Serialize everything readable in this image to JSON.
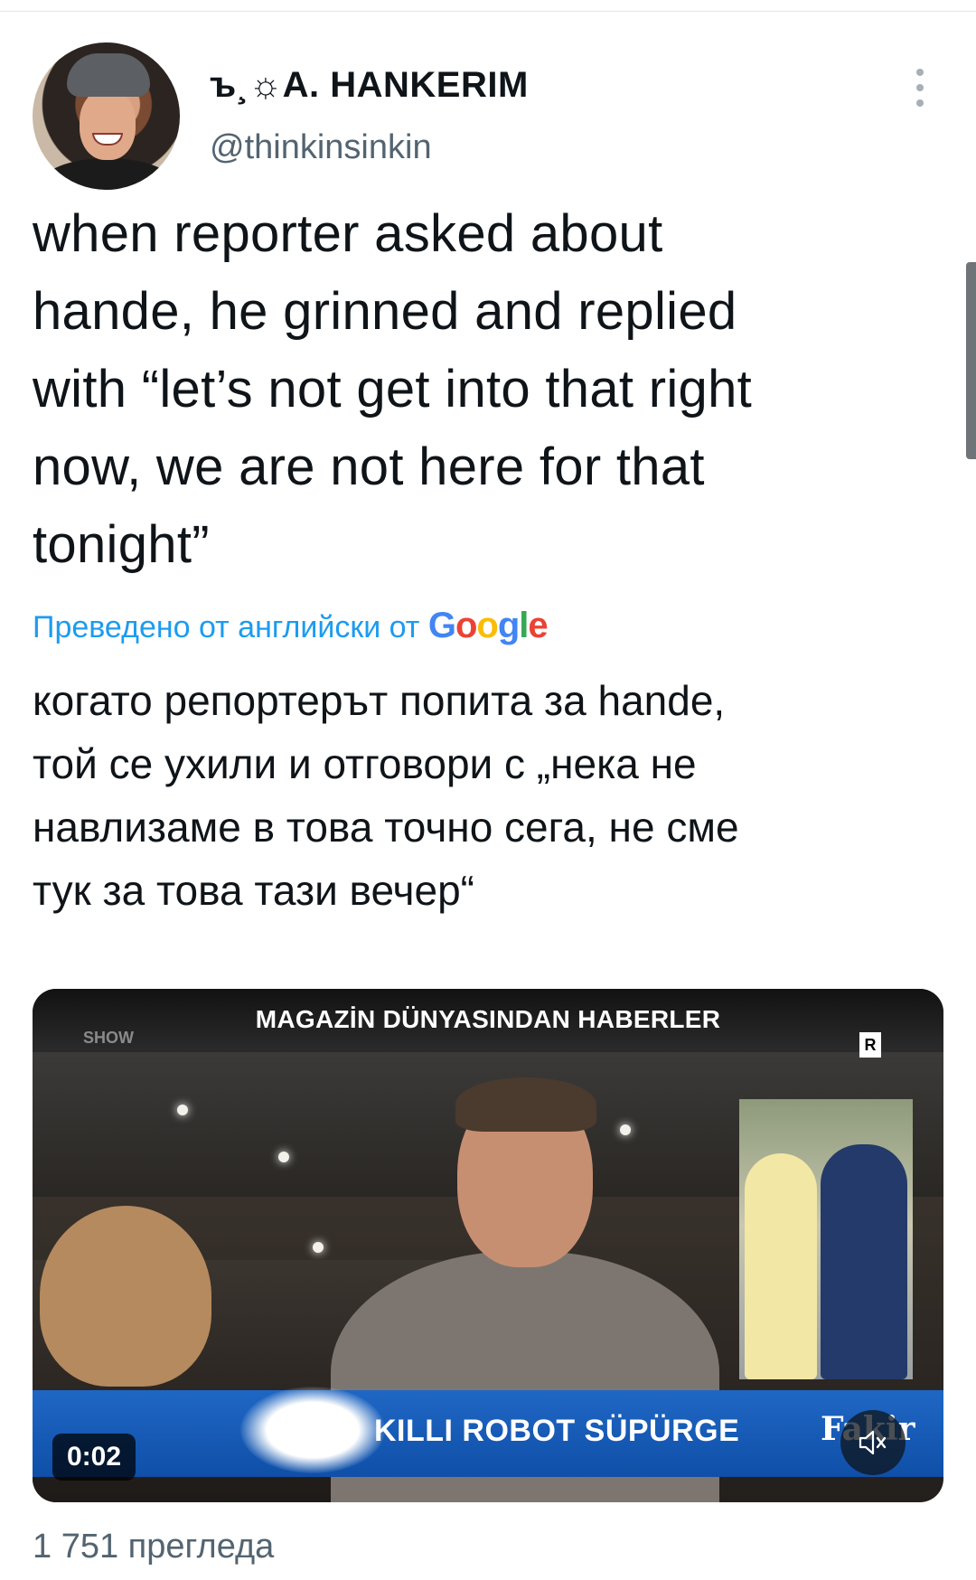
{
  "author": {
    "display_name": "ъ¸☼A. HANKERIM",
    "handle": "@thinkinsinkin"
  },
  "tweet": {
    "text": "when reporter asked about\nhande, he grinned and replied\nwith “let’s not get into that right\nnow, we are not here for that\ntonight”",
    "translated_by_label": "Преведено от английски от",
    "translator": "Google",
    "translation": "когато репортерът попита за hande,\nтой се ухили и отговори с „нека не\nнавлизаме в това точно сега, не сме\nтук за това тази вечер“"
  },
  "video": {
    "headline": "MAGAZİN DÜNYASINDAN HABERLER",
    "channel_logo": "SHOW",
    "rating_badge": "R",
    "lower_third": "KILLI ROBOT SÜPÜRGE",
    "sponsor": "Fakir",
    "timestamp": "0:02"
  },
  "stats": {
    "views": "1 751 прегледа"
  },
  "colors": {
    "link_blue": "#1d9bf0",
    "secondary_text": "#536471",
    "google": [
      "#4285f4",
      "#ea4335",
      "#fbbc05",
      "#4285f4",
      "#34a853",
      "#ea4335"
    ]
  },
  "icons": [
    "more-vertical-icon",
    "mute-icon"
  ]
}
